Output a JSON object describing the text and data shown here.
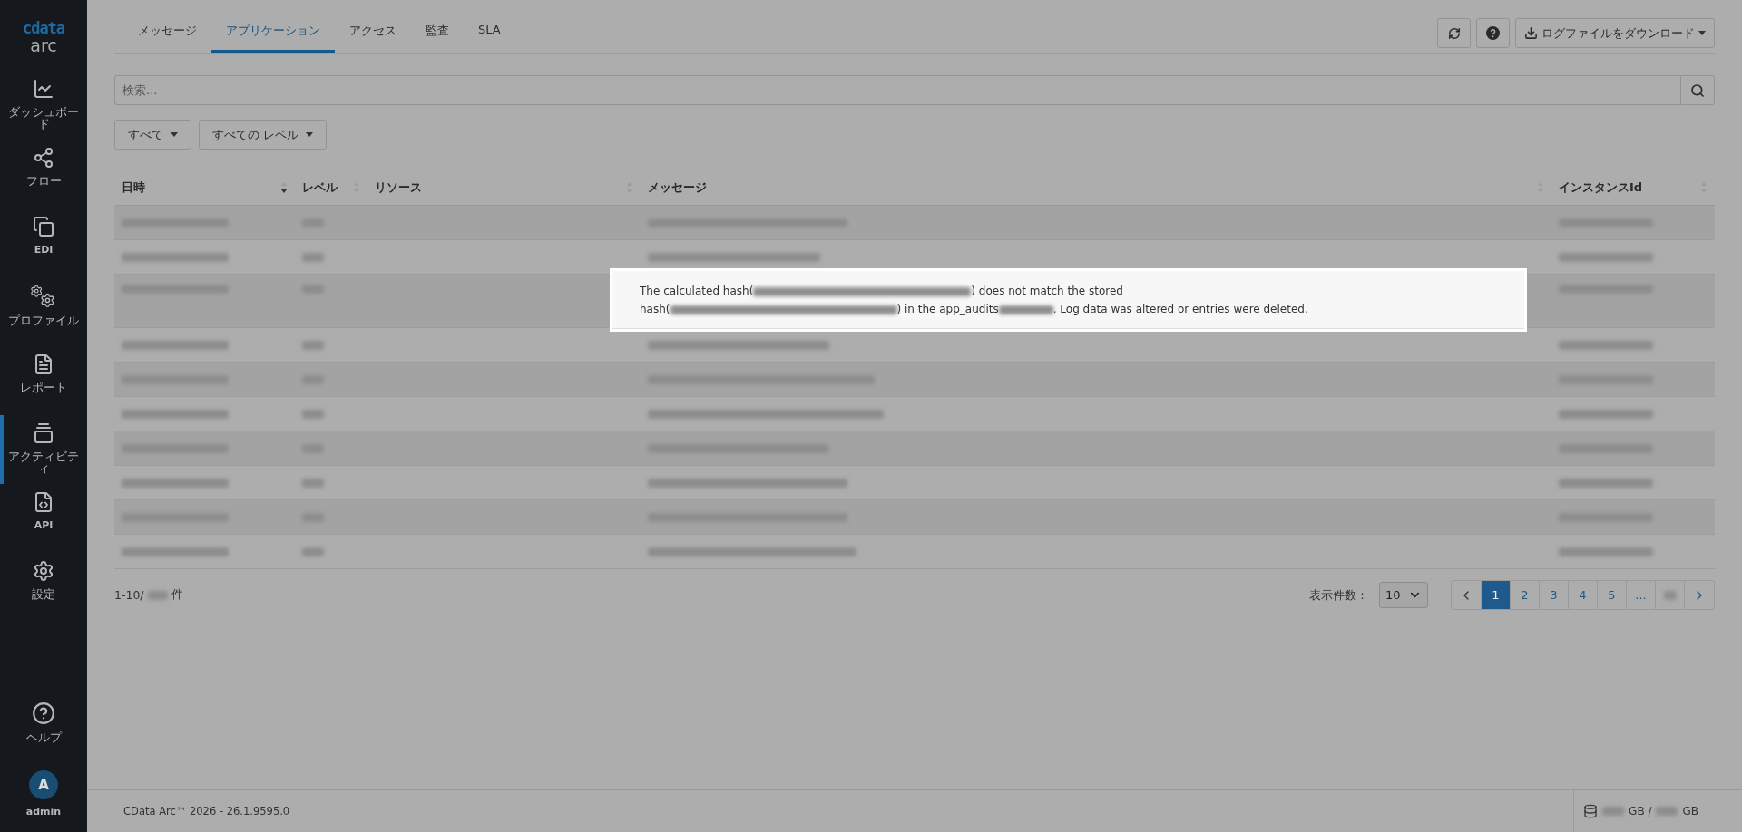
{
  "sidebar": {
    "logo": {
      "brand": "cdata",
      "product": "arc"
    },
    "items": [
      {
        "kind": "dashboard",
        "label": "ダッシュボード",
        "selected": false
      },
      {
        "kind": "flow",
        "label": "フロー",
        "selected": false
      },
      {
        "kind": "edi",
        "label": "EDI",
        "selected": false
      },
      {
        "kind": "profile",
        "label": "プロファイル",
        "selected": false
      },
      {
        "kind": "report",
        "label": "レポート",
        "selected": false
      },
      {
        "kind": "activity",
        "label": "アクティビティ",
        "selected": true
      },
      {
        "kind": "api",
        "label": "API",
        "selected": false
      },
      {
        "kind": "settings",
        "label": "設定",
        "selected": false
      }
    ],
    "help": {
      "label": "ヘルプ"
    },
    "user": {
      "initial": "A",
      "name": "admin"
    }
  },
  "tabs": [
    {
      "label": "メッセージ",
      "selected": false
    },
    {
      "label": "アプリケーション",
      "selected": true
    },
    {
      "label": "アクセス",
      "selected": false
    },
    {
      "label": "監査",
      "selected": false
    },
    {
      "label": "SLA",
      "selected": false
    }
  ],
  "toolbar": {
    "download_label": "ログファイルをダウンロード"
  },
  "search": {
    "placeholder": "検索..."
  },
  "filters": [
    "すべて",
    "すべての レベル"
  ],
  "table": {
    "columns": [
      {
        "label": "日時",
        "sorted": true
      },
      {
        "label": "レベル",
        "sorted": false
      },
      {
        "label": "リソース",
        "sorted": false
      },
      {
        "label": "メッセージ",
        "sorted": false
      },
      {
        "label": "インスタンスId",
        "sorted": false
      }
    ],
    "rows": [
      {
        "kind": "redacted"
      },
      {
        "kind": "redacted"
      },
      {
        "kind": "expanded",
        "message": [
          {
            "kind": "text",
            "text": "The calculated hash("
          },
          {
            "kind": "redacted"
          },
          {
            "kind": "text",
            "text": ") does not match the stored"
          },
          {
            "kind": "break"
          },
          {
            "kind": "text",
            "text": "hash("
          },
          {
            "kind": "redacted"
          },
          {
            "kind": "text",
            "text": ") in the app_audits"
          },
          {
            "kind": "redacted"
          },
          {
            "kind": "text",
            "text": ". Log data was altered or entries were deleted."
          }
        ]
      },
      {
        "kind": "redacted"
      },
      {
        "kind": "redacted"
      },
      {
        "kind": "redacted"
      },
      {
        "kind": "redacted"
      },
      {
        "kind": "redacted"
      },
      {
        "kind": "redacted"
      },
      {
        "kind": "redacted"
      }
    ]
  },
  "pager": {
    "count": [
      {
        "kind": "text",
        "text": "1-10/"
      },
      {
        "kind": "redacted"
      },
      {
        "kind": "text",
        "text": "件"
      }
    ],
    "page_size_label": "表示件数：",
    "page_size": "10",
    "pages": [
      {
        "label": "1",
        "selected": true
      },
      {
        "label": "2",
        "selected": false
      },
      {
        "label": "3",
        "selected": false
      },
      {
        "label": "4",
        "selected": false
      },
      {
        "label": "5",
        "selected": false
      },
      {
        "label": "...",
        "selected": false
      },
      {
        "kind": "redacted",
        "selected": false
      }
    ]
  },
  "footer": {
    "version": "CData Arc™ 2026 - 26.1.9595.0",
    "storage": [
      {
        "kind": "redacted"
      },
      {
        "kind": "text",
        "text": "GB /"
      },
      {
        "kind": "redacted"
      },
      {
        "kind": "text",
        "text": "GB"
      }
    ]
  }
}
